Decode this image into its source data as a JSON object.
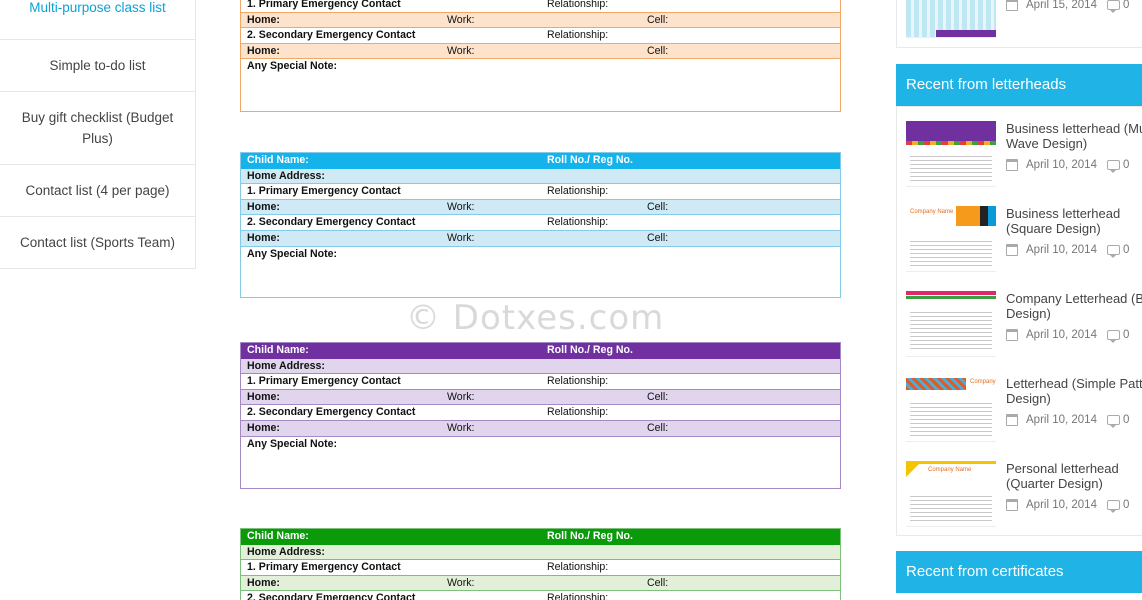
{
  "left_nav": {
    "items": [
      {
        "label": "Multi-purpose class list"
      },
      {
        "label": "Simple to-do list"
      },
      {
        "label": "Buy gift checklist (Budget Plus)"
      },
      {
        "label": "Contact list (4 per page)"
      },
      {
        "label": "Contact list (Sports Team)"
      }
    ]
  },
  "form_labels": {
    "child_name": "Child Name:",
    "roll_no": "Roll No./ Reg No.",
    "home_address": "Home Address:",
    "primary_contact": "1. Primary Emergency Contact",
    "secondary_contact": "2. Secondary Emergency Contact",
    "relationship": "Relationship:",
    "home": "Home:",
    "work": "Work:",
    "cell": "Cell:",
    "special_note": "Any Special Note:"
  },
  "form_colors": {
    "orange": {
      "border": "#f0a868",
      "band": "#fde2cc"
    },
    "blue": {
      "head": "#14b3ec",
      "border": "#85cbe8",
      "band": "#cfeaf5"
    },
    "purple": {
      "head": "#7030a0",
      "border": "#a48ac4",
      "band": "#e0d5ec"
    },
    "green": {
      "head": "#0a9a0a",
      "border": "#7cc07c",
      "band": "#e2f0d9"
    }
  },
  "watermark": "© Dotxes.com",
  "right_sidebar": {
    "top_post": {
      "date": "April 15, 2014",
      "comments": "0"
    },
    "letterheads_title": "Recent from letterheads",
    "posts": [
      {
        "title": "Business letterhead (Multi Wave Design)",
        "date": "April 10, 2014",
        "comments": "0",
        "thumb": "purple-wave"
      },
      {
        "title": "Business letterhead (Square Design)",
        "date": "April 10, 2014",
        "comments": "0",
        "thumb": "orange-squares"
      },
      {
        "title": "Company Letterhead (Bars Design)",
        "date": "April 10, 2014",
        "comments": "0",
        "thumb": "pink-green-bars"
      },
      {
        "title": "Letterhead (Simple Pattern Design)",
        "date": "April 10, 2014",
        "comments": "0",
        "thumb": "pattern-strip"
      },
      {
        "title": "Personal letterhead (Quarter Design)",
        "date": "April 10, 2014",
        "comments": "0",
        "thumb": "yellow-corner"
      }
    ],
    "certificates_title": "Recent from certificates"
  },
  "icons": {
    "date": "calendar-icon",
    "comments": "comment-icon"
  }
}
